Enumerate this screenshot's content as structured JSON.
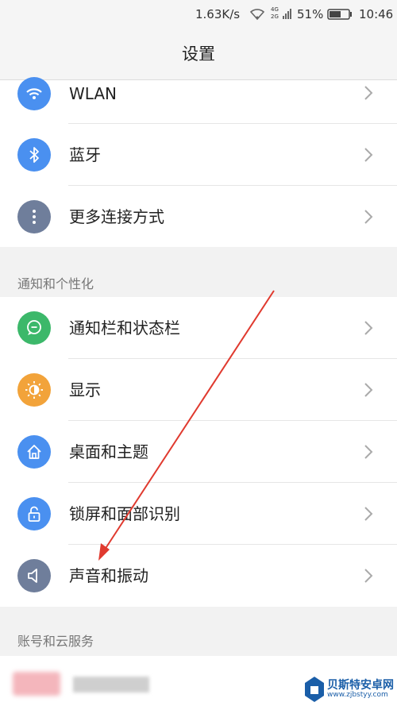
{
  "status_bar": {
    "speed": "1.63K/s",
    "network": "4G 2G",
    "battery": "51%",
    "time": "10:46"
  },
  "title": "设置",
  "connectivity": [
    {
      "label": "WLAN",
      "icon": "wifi-icon",
      "color": "#4a90f0"
    },
    {
      "label": "蓝牙",
      "icon": "bluetooth-icon",
      "color": "#4a90f0"
    },
    {
      "label": "更多连接方式",
      "icon": "more-dots-icon",
      "color": "#6f7e9b"
    }
  ],
  "section_notifications": "通知和个性化",
  "personalization": [
    {
      "label": "通知栏和状态栏",
      "icon": "chat-bubble-icon",
      "color": "#3cb86a"
    },
    {
      "label": "显示",
      "icon": "brightness-icon",
      "color": "#f2a33a"
    },
    {
      "label": "桌面和主题",
      "icon": "home-icon",
      "color": "#4a90f0"
    },
    {
      "label": "锁屏和面部识别",
      "icon": "lock-icon",
      "color": "#4a90f0"
    },
    {
      "label": "声音和振动",
      "icon": "speaker-icon",
      "color": "#6f7e9b"
    }
  ],
  "section_account": "账号和云服务",
  "watermark": {
    "name": "贝斯特安卓网",
    "url": "www.zjbstyy.com"
  },
  "annotation_color": "#e03a2f"
}
